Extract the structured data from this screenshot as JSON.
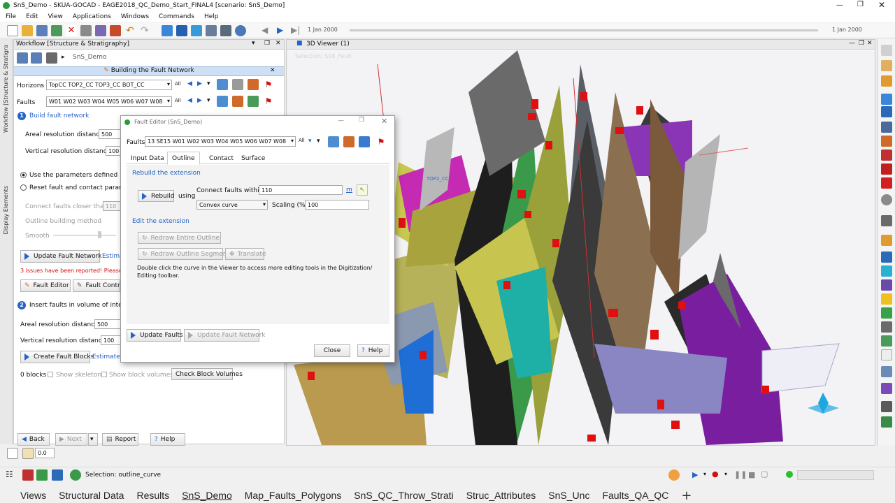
{
  "app": {
    "title": "SnS_Demo - SKUA-GOCAD - EAGE2018_QC_Demo_Start_FINAL4 [scenario: SnS_Demo]",
    "menu": [
      "File",
      "Edit",
      "View",
      "Applications",
      "Windows",
      "Commands",
      "Help"
    ],
    "toolbar": {
      "date_left": "1 Jan 2000",
      "date_right": "1 Jan 2000"
    }
  },
  "left_tabs": [
    "Workflow [Structure & Stratigra",
    "Display Elements"
  ],
  "workflow": {
    "title": "Workflow [Structure & Stratigraphy]",
    "breadcrumb": "SnS_Demo",
    "section_title": "Building the Fault Network",
    "horizons_label": "Horizons",
    "horizons_value": "TopCC TOP2_CC TOP3_CC BOT_CC",
    "faults_label": "Faults",
    "faults_value": "W01 W02 W03 W04 W05 W06 W07 W08",
    "all_label": "All",
    "step1_num": "1",
    "step1_label": "Build fault network",
    "areal_label": "Areal resolution distance",
    "areal_value": "500",
    "vertical_label": "Vertical resolution distance",
    "vertical_value": "100",
    "radio1": "Use the parameters defined in th",
    "radio2": "Reset fault and contact paramete",
    "connect_label": "Connect faults closer than",
    "connect_value": "110",
    "outline_label": "Outline building method",
    "smooth_label": "Smooth",
    "update_network": "Update Fault Network",
    "estimated1": "Estima",
    "issues": "3 issues have been reported! Please",
    "fault_editor": "Fault Editor",
    "fault_contr": "Fault Contro",
    "step2_num": "2",
    "step2_label": "Insert faults in volume of interest",
    "areal2_label": "Areal resolution distance",
    "areal2_value": "500",
    "vertical2_label": "Vertical resolution distance",
    "vertical2_value": "100",
    "create_blocks": "Create Fault Blocks",
    "estimated2": "Estimated",
    "blocks_count": "0 blocks",
    "show_skeleton": "Show skeleton",
    "show_block_volumes": "Show block volumes",
    "check_block": "Check Block Volumes",
    "back": "Back",
    "next": "Next",
    "report": "Report",
    "help": "Help",
    "zoom": "0.0"
  },
  "dialog": {
    "title": "Fault Editor (SnS_Demo)",
    "faults_label": "Faults",
    "faults_value": "13 SE15 W01 W02 W03 W04 W05 W06 W07 W08",
    "all_label": "All",
    "tabs": [
      "Input Data",
      "Outline",
      "Contact",
      "Surface"
    ],
    "active_tab": "Outline",
    "rebuild_section": "Rebuild the extension",
    "rebuild_btn": "Rebuild",
    "using": "using",
    "connect_label": "Connect faults within",
    "connect_value": "110",
    "unit": "m",
    "method": "Convex curve",
    "scaling_label": "Scaling (%)",
    "scaling_value": "100",
    "edit_section": "Edit the extension",
    "redraw_entire": "Redraw Entire Outline",
    "redraw_segment": "Redraw Outline Segment",
    "translate": "Translate",
    "hint": "Double click the curve in the Viewer to access more editing tools in the Digitization/ Editing toolbar.",
    "update_faults": "Update Faults",
    "update_network": "Update Fault Network",
    "close": "Close",
    "help": "Help"
  },
  "viewer": {
    "title": "3D Viewer (1)",
    "selection_overlay": "Selection: S18_Fault",
    "label_top2": "TOP2_CC"
  },
  "status": {
    "selection": "Selection: outline_curve"
  },
  "bottom_tabs": [
    "Views",
    "Structural Data",
    "Results",
    "SnS_Demo",
    "Map_Faults_Polygons",
    "SnS_QC_Throw_Strati",
    "Struc_Attributes",
    "SnS_Unc",
    "Faults_QA_QC"
  ],
  "active_bottom_tab": "SnS_Demo",
  "colors": {
    "accent": "#2463c7",
    "header_bg": "#cfe0f5",
    "issue_red": "#d01010"
  }
}
